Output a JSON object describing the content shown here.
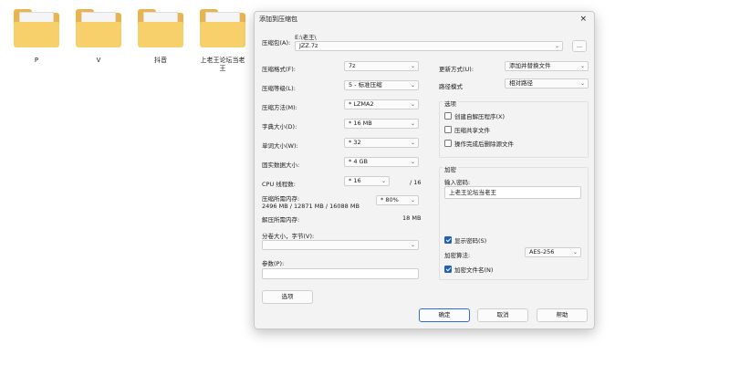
{
  "desktop": {
    "folders": [
      {
        "label": "P"
      },
      {
        "label": "V"
      },
      {
        "label": "抖音"
      },
      {
        "label": "上老王论坛当老\n王"
      }
    ]
  },
  "dialog": {
    "title": "添加到压缩包",
    "close_icon": "×",
    "archive_label": "压缩包(A):",
    "archive_dir": "E:\\老王\\",
    "archive_name": "JZZ.7z",
    "browse_label": "...",
    "format_label": "压缩格式(F):",
    "format_value": "7z",
    "level_label": "压缩等级(L):",
    "level_value": "5 - 标准压缩",
    "method_label": "压缩方法(M):",
    "method_value": "* LZMA2",
    "dict_label": "字典大小(D):",
    "dict_value": "* 16 MB",
    "word_label": "单词大小(W):",
    "word_value": "* 32",
    "solid_label": "固实数据大小:",
    "solid_value": "* 4 GB",
    "threads_label": "CPU 线程数:",
    "threads_value": "* 16",
    "threads_total": "/ 16",
    "mem_comp_label": "压缩所需内存:",
    "mem_comp_value": "2496 MB / 12871 MB / 16088 MB",
    "mem_percent": "* 80%",
    "mem_decomp_label": "解压所需内存:",
    "mem_decomp_value": "18 MB",
    "split_label": "分卷大小，字节(V):",
    "split_value": "",
    "params_label": "参数(P):",
    "params_value": "",
    "options_button": "选项",
    "update_label": "更新方式(U):",
    "update_value": "添加并替换文件",
    "path_label": "路径模式",
    "path_value": "相对路径",
    "options_group": "选项",
    "opt_sfx": "创建自解压程序(X)",
    "opt_shared": "压缩共享文件",
    "opt_delete": "操作完成后删除源文件",
    "encrypt_group": "加密",
    "password_label": "输入密码:",
    "password_value": "上老王论坛当老王",
    "show_password": "显示密码(S)",
    "enc_method_label": "加密算法:",
    "enc_method_value": "AES-256",
    "encrypt_names": "加密文件名(N)",
    "ok_button": "确定",
    "cancel_button": "取消",
    "help_button": "帮助",
    "dropdown_arrow": "⌄"
  },
  "colors": {
    "accent": "#1f5fbf",
    "folder": "#f7cf6b"
  }
}
